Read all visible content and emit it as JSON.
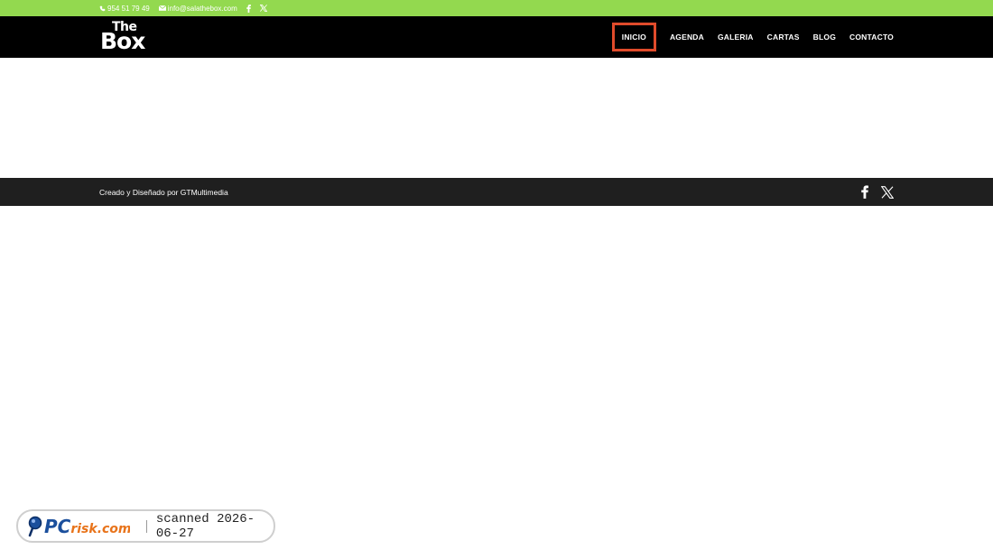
{
  "topbar": {
    "phone": "954 51 79 49",
    "email": "info@salathebox.com",
    "social_icons": [
      "facebook-icon",
      "x-icon"
    ]
  },
  "header": {
    "logo_top": "The",
    "logo_bottom": "Box",
    "nav": [
      {
        "label": "INICIO",
        "active": true
      },
      {
        "label": "AGENDA"
      },
      {
        "label": "GALERIA"
      },
      {
        "label": "CARTAS"
      },
      {
        "label": "BLOG"
      },
      {
        "label": "CONTACTO"
      }
    ]
  },
  "footer": {
    "credit": "Creado y Diseñado por GTMultimedia",
    "social_icons": [
      "facebook-icon",
      "x-icon"
    ]
  },
  "watermark": {
    "brand": "PCrisk.com",
    "scan_text": "scanned 2026-06-27"
  },
  "colors": {
    "topbar": "#93d94f",
    "header": "#000000",
    "footer": "#1f1f1f",
    "active_outline": "#e04b2b"
  }
}
